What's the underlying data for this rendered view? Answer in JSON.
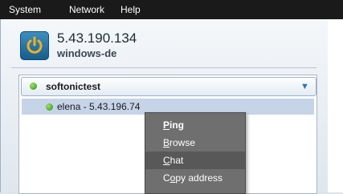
{
  "menubar": {
    "system": "System",
    "network": "Network",
    "help": "Help"
  },
  "account": {
    "ip": "5.43.190.134",
    "host": "windows-de",
    "status_icon": "power-icon"
  },
  "network": {
    "name": "softonictest",
    "member": "elena - 5.43.196.74",
    "online_color": "#3aa519",
    "collapse_icon": "chevron-down-icon"
  },
  "context_menu": {
    "items": [
      {
        "label": "Ping",
        "bold": true
      },
      {
        "label": "Browse"
      },
      {
        "label": "Chat",
        "highlighted": true
      },
      {
        "label": "Copy address"
      }
    ]
  }
}
